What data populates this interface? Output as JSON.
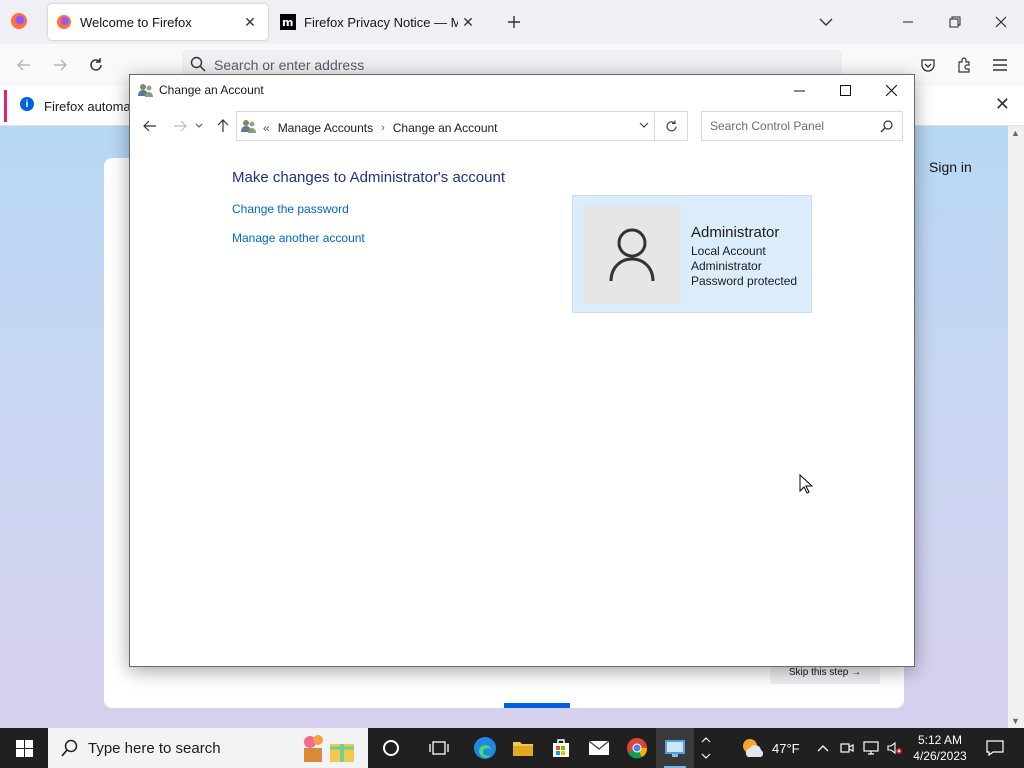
{
  "browser": {
    "tabs": [
      {
        "label": "Welcome to Firefox",
        "active": true
      },
      {
        "label": "Firefox Privacy Notice — Mozilla",
        "active": false
      }
    ],
    "address_placeholder": "Search or enter address",
    "notice_text": "Firefox automation",
    "page": {
      "sign_in": "Sign in",
      "skip_label": "Skip this step →"
    }
  },
  "window": {
    "title": "Change an Account",
    "breadcrumb": {
      "prefix": "«",
      "items": [
        "Manage Accounts",
        "Change an Account"
      ]
    },
    "search_placeholder": "Search Control Panel",
    "heading": "Make changes to Administrator's account",
    "links": [
      "Change the password",
      "Manage another account"
    ],
    "account": {
      "name": "Administrator",
      "details": [
        "Local Account",
        "Administrator",
        "Password protected"
      ]
    }
  },
  "taskbar": {
    "search_placeholder": "Type here to search",
    "weather": "47°F",
    "time": "5:12 AM",
    "date": "4/26/2023"
  },
  "colors": {
    "link": "#0066cc",
    "heading": "#1e3287",
    "card_bg": "#dbecfa",
    "accent": "#0060df"
  }
}
